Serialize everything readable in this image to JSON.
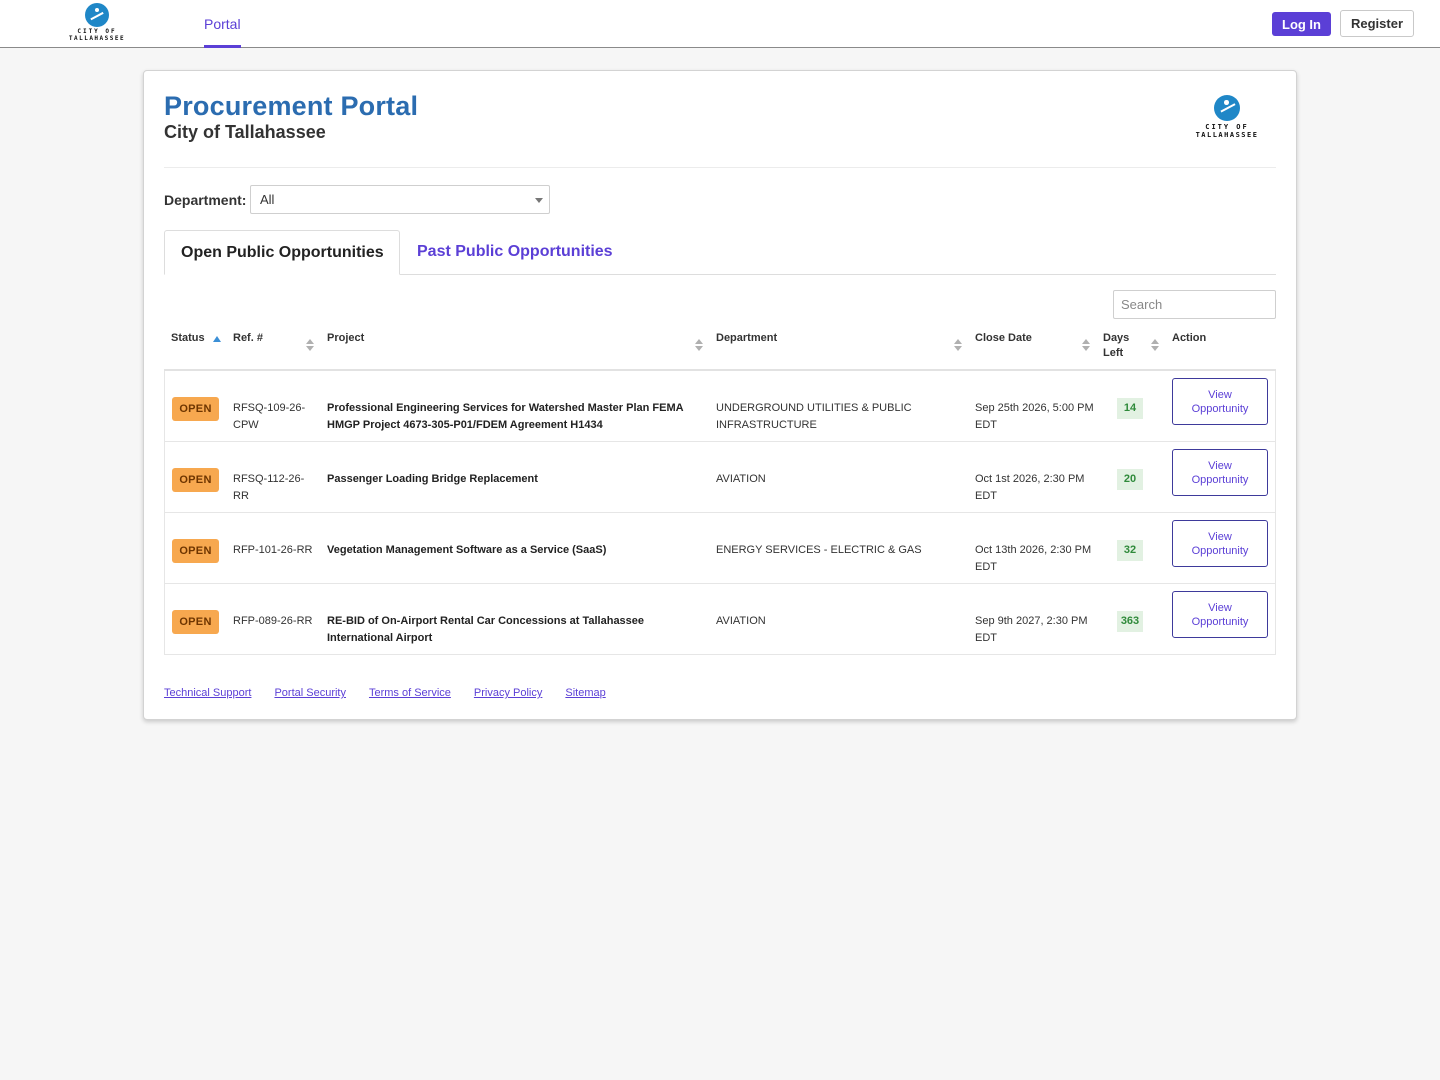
{
  "nav": {
    "logo_line1": "CITY OF",
    "logo_line2": "TALLAHASSEE",
    "portal_label": "Portal",
    "login_label": "Log In",
    "register_label": "Register"
  },
  "header": {
    "title": "Procurement Portal",
    "subtitle": "City of Tallahassee",
    "logo_line1": "CITY OF",
    "logo_line2": "TALLAHASSEE"
  },
  "filter": {
    "department_label": "Department:",
    "department_value": "All"
  },
  "tabs": [
    {
      "label": "Open Public Opportunities",
      "active": true
    },
    {
      "label": "Past Public Opportunities",
      "active": false
    }
  ],
  "search": {
    "placeholder": "Search"
  },
  "table": {
    "columns": [
      "Status",
      "Ref. #",
      "Project",
      "Department",
      "Close Date",
      "Days Left",
      "Action"
    ],
    "sorted_column": "Status",
    "rows": [
      {
        "status": "OPEN",
        "ref": "RFSQ-109-26-CPW",
        "project": "Professional Engineering Services for Watershed Master Plan FEMA HMGP Project 4673-305-P01/FDEM Agreement H1434",
        "department": "UNDERGROUND UTILITIES & PUBLIC INFRASTRUCTURE",
        "close_date": "Sep 25th 2026, 5:00 PM EDT",
        "days_left": "14",
        "action": "View Opportunity"
      },
      {
        "status": "OPEN",
        "ref": "RFSQ-112-26-RR",
        "project": "Passenger Loading Bridge Replacement",
        "department": "AVIATION",
        "close_date": "Oct 1st 2026, 2:30 PM EDT",
        "days_left": "20",
        "action": "View Opportunity"
      },
      {
        "status": "OPEN",
        "ref": "RFP-101-26-RR",
        "project": "Vegetation Management Software as a Service (SaaS)",
        "department": "ENERGY SERVICES - ELECTRIC & GAS",
        "close_date": "Oct 13th 2026, 2:30 PM EDT",
        "days_left": "32",
        "action": "View Opportunity"
      },
      {
        "status": "OPEN",
        "ref": "RFP-089-26-RR",
        "project": "RE-BID of On-Airport Rental Car Concessions at Tallahassee International Airport",
        "department": "AVIATION",
        "close_date": "Sep 9th 2027, 2:30 PM EDT",
        "days_left": "363",
        "action": "View Opportunity"
      }
    ]
  },
  "footer": {
    "links": [
      "Technical Support",
      "Portal Security",
      "Terms of Service",
      "Privacy Policy",
      "Sitemap"
    ]
  },
  "colors": {
    "accent": "#5b3fd6",
    "title_blue": "#2b6cb0",
    "open_badge": "#f7a84f",
    "days_badge_bg": "#e2f1e2",
    "days_badge_text": "#2f8a3a",
    "logo_blue": "#1f87c7"
  },
  "icons": [
    "city-logo",
    "dropdown-caret-icon",
    "sort-asc-icon",
    "sort-icon"
  ]
}
